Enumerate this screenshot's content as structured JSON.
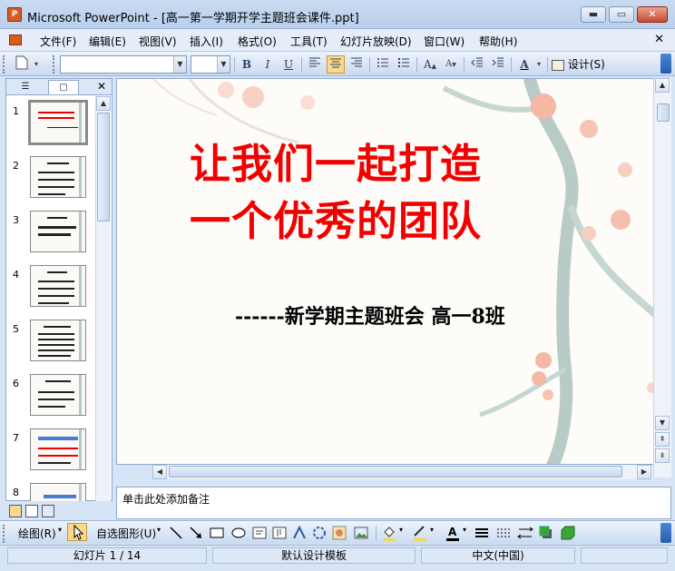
{
  "window": {
    "app_icon_label": "P",
    "title": "Microsoft PowerPoint - [高一第一学期开学主题班会课件.ppt]",
    "min_label": "▬",
    "max_label": "▭",
    "close_label": "✕"
  },
  "menu": {
    "items": [
      "文件(F)",
      "编辑(E)",
      "视图(V)",
      "插入(I)",
      "格式(O)",
      "工具(T)",
      "幻灯片放映(D)",
      "窗口(W)",
      "帮助(H)"
    ],
    "doc_close": "✕"
  },
  "toolbar": {
    "font_name": "",
    "font_size": "",
    "bold": "B",
    "italic": "I",
    "underline": "U",
    "font_color": "A",
    "design_label": "设计(S)"
  },
  "left_pane": {
    "tab_outline": "☰",
    "tab_slides": "▢",
    "close": "✕",
    "slide_numbers": [
      "1",
      "2",
      "3",
      "4",
      "5",
      "6",
      "7",
      "8"
    ]
  },
  "slide": {
    "title_line1": "让我们一起打造",
    "title_line2": "一个优秀的团队",
    "subtitle": "------新学期主题班会  高一8班"
  },
  "notes": {
    "placeholder": "单击此处添加备注"
  },
  "drawing": {
    "draw_label": "绘图(R)",
    "autoshapes_label": "自选图形(U)"
  },
  "status": {
    "slide_position": "幻灯片 1 / 14",
    "design_template": "默认设计模板",
    "language": "中文(中国)"
  },
  "colors": {
    "title_red": "#f20000",
    "chrome_blue": "#c9daf1"
  }
}
